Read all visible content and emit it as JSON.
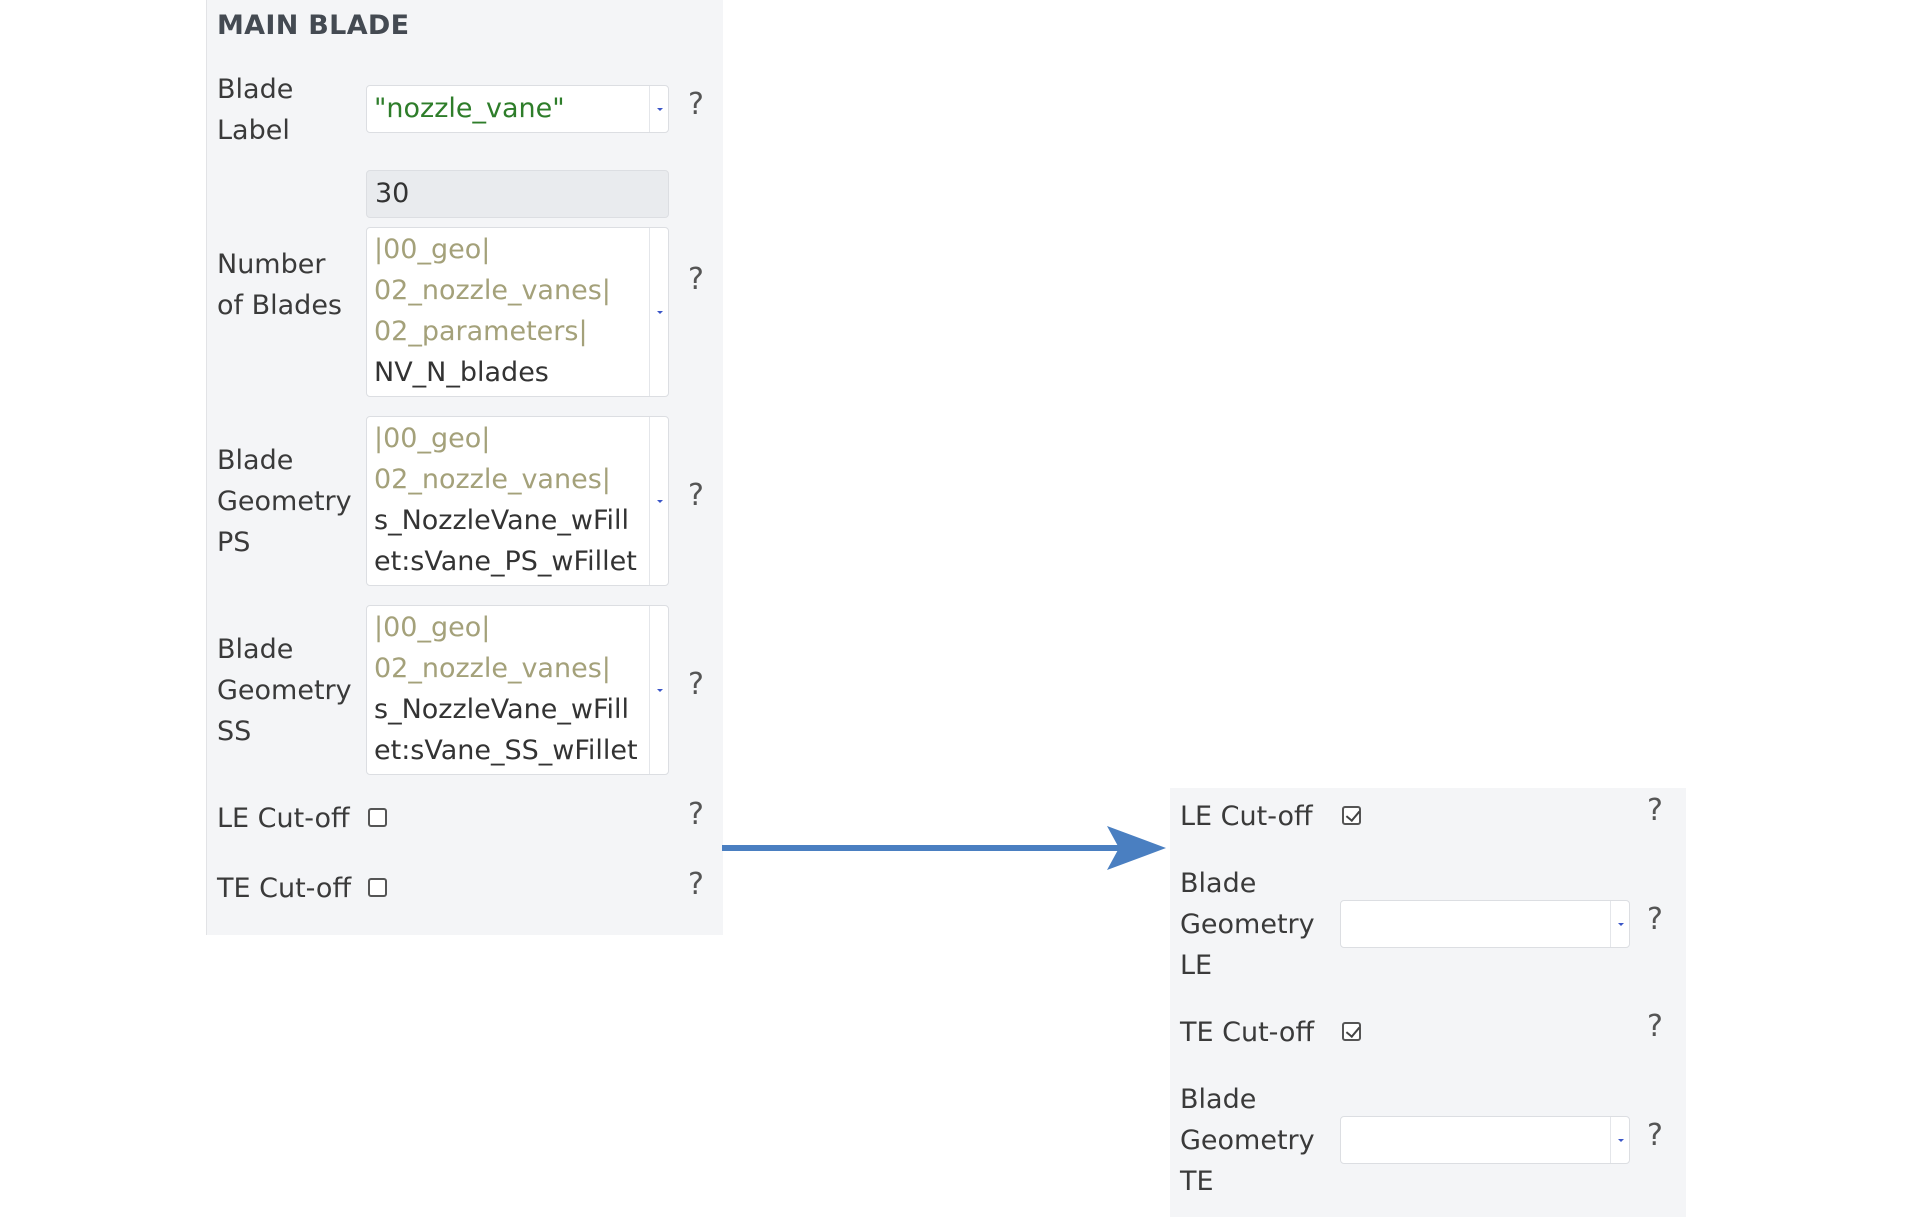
{
  "main_blade": {
    "title": "MAIN BLADE",
    "help": "?",
    "blade_label": {
      "label_line1": "Blade",
      "label_line2": "Label",
      "value": "\"nozzle_vane\""
    },
    "number_of_blades": {
      "label_line1": "Number",
      "label_line2": "of Blades",
      "value": "30",
      "path": [
        "|00_geo|",
        "02_nozzle_vanes|",
        "02_parameters|"
      ],
      "path_end": "NV_N_blades"
    },
    "blade_geometry_ps": {
      "label_line1": "Blade",
      "label_line2": "Geometry",
      "label_line3": "PS",
      "path": [
        "|00_geo|",
        "02_nozzle_vanes|"
      ],
      "path_end_line1": "s_NozzleVane_wFill",
      "path_end_line2": "et:sVane_PS_wFillet"
    },
    "blade_geometry_ss": {
      "label_line1": "Blade",
      "label_line2": "Geometry",
      "label_line3": "SS",
      "path": [
        "|00_geo|",
        "02_nozzle_vanes|"
      ],
      "path_end_line1": "s_NozzleVane_wFill",
      "path_end_line2": "et:sVane_SS_wFillet"
    },
    "le_cutoff": {
      "label": "LE Cut-off",
      "checked": false
    },
    "te_cutoff": {
      "label": "TE Cut-off",
      "checked": false
    }
  },
  "expanded": {
    "help": "?",
    "le_cutoff": {
      "label": "LE Cut-off",
      "checked": true
    },
    "blade_geometry_le": {
      "label_line1": "Blade",
      "label_line2": "Geometry",
      "label_line3": "LE",
      "value": ""
    },
    "te_cutoff": {
      "label": "TE Cut-off",
      "checked": true
    },
    "blade_geometry_te": {
      "label_line1": "Blade",
      "label_line2": "Geometry",
      "label_line3": "TE",
      "value": ""
    }
  },
  "colors": {
    "panel_bg": "#f4f5f7",
    "value_green": "#2e7d2a",
    "path_olive": "#a4a17a",
    "arrow_blue": "#4a7fc1",
    "caret_blue": "#3b55c7"
  },
  "icons": {
    "arrow": "right-arrow-icon",
    "dropdown": "chevron-down-icon",
    "checkbox": "checkbox-icon"
  }
}
